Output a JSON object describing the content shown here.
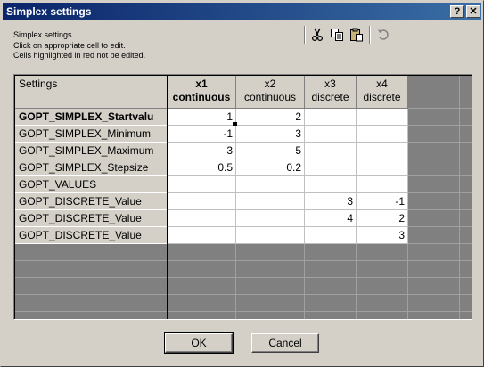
{
  "window": {
    "title": "Simplex settings",
    "help_glyph": "?",
    "close_glyph": "✕"
  },
  "info": {
    "heading": "Simplex settings",
    "line1": "Click on appropriate cell to edit.",
    "line2": "Cells highlighted in red not be edited."
  },
  "toolbar": {
    "icons": [
      "cut-icon",
      "copy-icon",
      "paste-icon",
      "undo-icon"
    ]
  },
  "grid": {
    "corner_label": "Settings",
    "columns": [
      {
        "name": "x1",
        "type": "continuous",
        "bold": true
      },
      {
        "name": "x2",
        "type": "continuous",
        "bold": false
      },
      {
        "name": "x3",
        "type": "discrete",
        "bold": false
      },
      {
        "name": "x4",
        "type": "discrete",
        "bold": false
      }
    ],
    "rows": [
      {
        "label": "GOPT_SIMPLEX_Startvalu",
        "bold": true,
        "values": [
          "1",
          "2",
          "",
          ""
        ]
      },
      {
        "label": "GOPT_SIMPLEX_Minimum",
        "bold": false,
        "values": [
          "-1",
          "3",
          "",
          ""
        ]
      },
      {
        "label": "GOPT_SIMPLEX_Maximum",
        "bold": false,
        "values": [
          "3",
          "5",
          "",
          ""
        ]
      },
      {
        "label": "GOPT_SIMPLEX_Stepsize",
        "bold": false,
        "values": [
          "0.5",
          "0.2",
          "",
          ""
        ]
      },
      {
        "label": "GOPT_VALUES",
        "bold": false,
        "values": [
          "",
          "",
          "",
          ""
        ]
      },
      {
        "label": "GOPT_DISCRETE_Value",
        "bold": false,
        "values": [
          "",
          "",
          "3",
          "-1"
        ]
      },
      {
        "label": "GOPT_DISCRETE_Value",
        "bold": false,
        "values": [
          "",
          "",
          "4",
          "2"
        ]
      },
      {
        "label": "GOPT_DISCRETE_Value",
        "bold": false,
        "values": [
          "",
          "",
          "",
          "3"
        ]
      }
    ]
  },
  "buttons": {
    "ok": "OK",
    "cancel": "Cancel"
  }
}
